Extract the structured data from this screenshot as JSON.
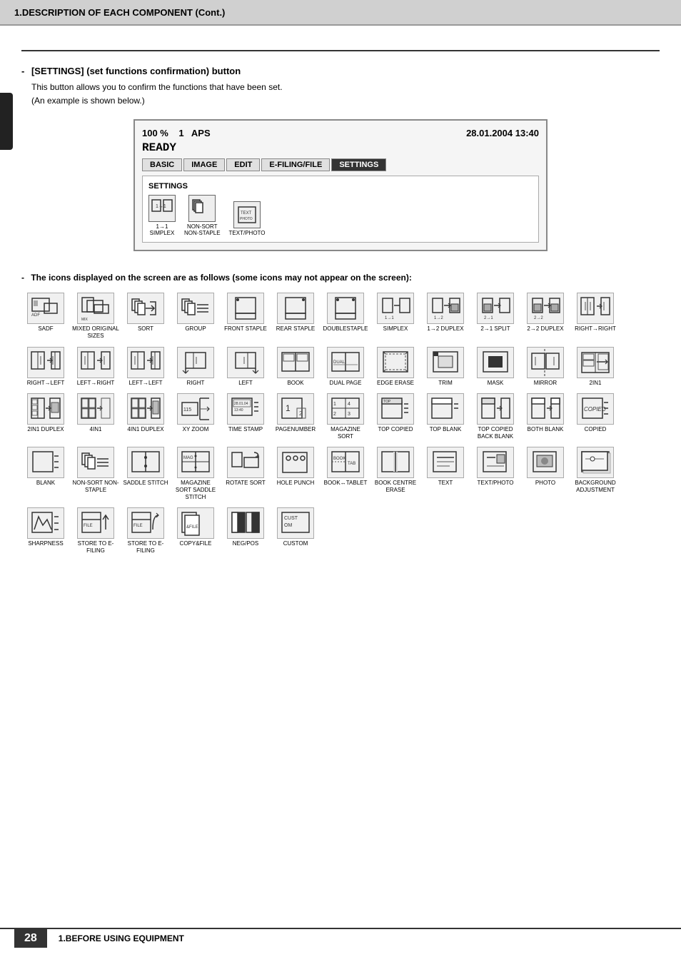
{
  "header": {
    "title": "1.DESCRIPTION OF EACH COMPONENT (Cont.)"
  },
  "section1": {
    "dash": "-",
    "heading": "[SETTINGS] (set functions confirmation) button",
    "body_line1": "This button allows you to confirm the functions that have been set.",
    "body_line2": "(An example is shown below.)"
  },
  "screen": {
    "percent": "100 %",
    "num": "1",
    "mode": "APS",
    "datetime": "28.01.2004 13:40",
    "ready": "READY",
    "tabs": [
      "BASIC",
      "IMAGE",
      "EDIT",
      "E-FILING/FILE",
      "SETTINGS"
    ],
    "active_tab": "SETTINGS",
    "body_title": "SETTINGS",
    "icons": [
      {
        "label": "1→1\nSIMPLEX"
      },
      {
        "label": "NON-SORT\nNON-STAPLE"
      },
      {
        "label": "TEXT/PHOTO"
      }
    ]
  },
  "section2": {
    "dash": "-",
    "heading": "The icons displayed on the screen are as follows (some icons may not appear on the screen):"
  },
  "icons": [
    {
      "id": "sadf",
      "label": "SADF"
    },
    {
      "id": "mixed-original-sizes",
      "label": "MIXED ORIGINAL SIZES"
    },
    {
      "id": "sort",
      "label": "SORT"
    },
    {
      "id": "group",
      "label": "GROUP"
    },
    {
      "id": "front-staple",
      "label": "FRONT STAPLE"
    },
    {
      "id": "rear-staple",
      "label": "REAR STAPLE"
    },
    {
      "id": "double-staple",
      "label": "DOUBLESTAPLE"
    },
    {
      "id": "simplex",
      "label": "SIMPLEX"
    },
    {
      "id": "1-2-duplex",
      "label": "1→2\nDUPLEX"
    },
    {
      "id": "2-1-split",
      "label": "2→1\nSPLIT"
    },
    {
      "id": "2-2-duplex",
      "label": "2→2\nDUPLEX"
    },
    {
      "id": "right-right",
      "label": "RIGHT→RIGHT"
    },
    {
      "id": "right-left",
      "label": "RIGHT→LEFT"
    },
    {
      "id": "left-right",
      "label": "LEFT→RIGHT"
    },
    {
      "id": "left-left",
      "label": "LEFT→LEFT"
    },
    {
      "id": "right",
      "label": "RIGHT"
    },
    {
      "id": "left",
      "label": "LEFT"
    },
    {
      "id": "book",
      "label": "BOOK"
    },
    {
      "id": "dual-page",
      "label": "DUAL PAGE"
    },
    {
      "id": "edge-erase",
      "label": "EDGE ERASE"
    },
    {
      "id": "trim",
      "label": "TRIM"
    },
    {
      "id": "mask",
      "label": "MASK"
    },
    {
      "id": "mirror",
      "label": "MIRROR"
    },
    {
      "id": "2in1",
      "label": "2IN1"
    },
    {
      "id": "2in1-duplex",
      "label": "2IN1 DUPLEX"
    },
    {
      "id": "4in1",
      "label": "4IN1"
    },
    {
      "id": "4in1-duplex",
      "label": "4IN1 DUPLEX"
    },
    {
      "id": "xy-zoom",
      "label": "XY ZOOM"
    },
    {
      "id": "time-stamp",
      "label": "TIME STAMP"
    },
    {
      "id": "page-number",
      "label": "PAGENUMBER"
    },
    {
      "id": "magazine-sort",
      "label": "MAGAZINE SORT"
    },
    {
      "id": "top-copied",
      "label": "TOP COPIED"
    },
    {
      "id": "top-blank",
      "label": "TOP BLANK"
    },
    {
      "id": "top-copied-back-blank",
      "label": "TOP COPIED BACK BLANK"
    },
    {
      "id": "both-blank",
      "label": "BOTH BLANK"
    },
    {
      "id": "copied",
      "label": "COPIED"
    },
    {
      "id": "blank",
      "label": "BLANK"
    },
    {
      "id": "non-sort-non-staple",
      "label": "NON-SORT NON-STAPLE"
    },
    {
      "id": "saddle-stitch",
      "label": "SADDLE STITCH"
    },
    {
      "id": "magazine-sort-saddle-stitch",
      "label": "MAGAZINE SORT SADDLE STITCH"
    },
    {
      "id": "rotate-sort",
      "label": "ROTATE SORT"
    },
    {
      "id": "hole-punch",
      "label": "HOLE PUNCH"
    },
    {
      "id": "book-tablet",
      "label": "BOOK↔TABLET"
    },
    {
      "id": "book-centre-erase",
      "label": "BOOK CENTRE ERASE"
    },
    {
      "id": "text",
      "label": "TEXT"
    },
    {
      "id": "text-photo",
      "label": "TEXT/PHOTO"
    },
    {
      "id": "photo",
      "label": "PHOTO"
    },
    {
      "id": "background-adjustment",
      "label": "BACKGROUND ADJUSTMENT"
    },
    {
      "id": "sharpness",
      "label": "SHARPNESS"
    },
    {
      "id": "store-to-efiling-1",
      "label": "STORE TO E-FILING"
    },
    {
      "id": "store-to-efiling-2",
      "label": "STORE TO E-FILING"
    },
    {
      "id": "copy-file",
      "label": "COPY&FILE"
    },
    {
      "id": "neg-pos",
      "label": "NEG/POS"
    },
    {
      "id": "custom",
      "label": "CUSTOM"
    }
  ],
  "footer": {
    "page_number": "28",
    "text": "1.BEFORE USING EQUIPMENT"
  }
}
